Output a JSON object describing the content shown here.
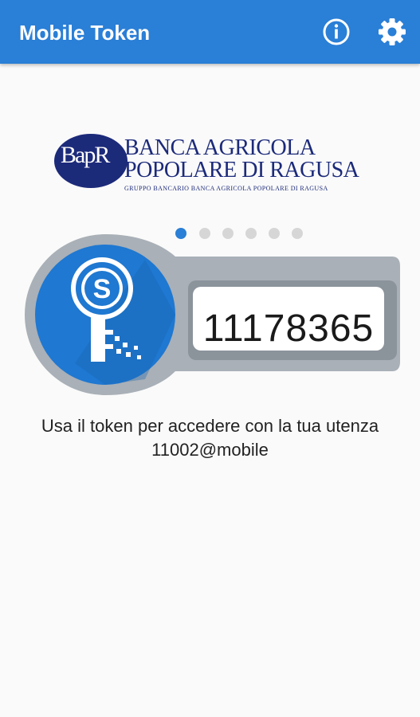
{
  "appbar": {
    "title": "Mobile Token",
    "info_icon": "info-icon",
    "settings_icon": "gear-icon",
    "color": "#2a7fd6"
  },
  "logo": {
    "monogram": "BapR",
    "line1": "BANCA AGRICOLA",
    "line2": "POPOLARE DI RAGUSA",
    "subtitle": "GRUPPO BANCARIO BANCA AGRICOLA POPOLARE DI RAGUSA",
    "color": "#1c2a7a"
  },
  "pager": {
    "count": 6,
    "active_index": 0
  },
  "token": {
    "code": "11178365",
    "key_icon": "key-icon"
  },
  "message": {
    "line1": "Usa il token per accedere con la tua utenza",
    "line2": "11002@mobile"
  }
}
